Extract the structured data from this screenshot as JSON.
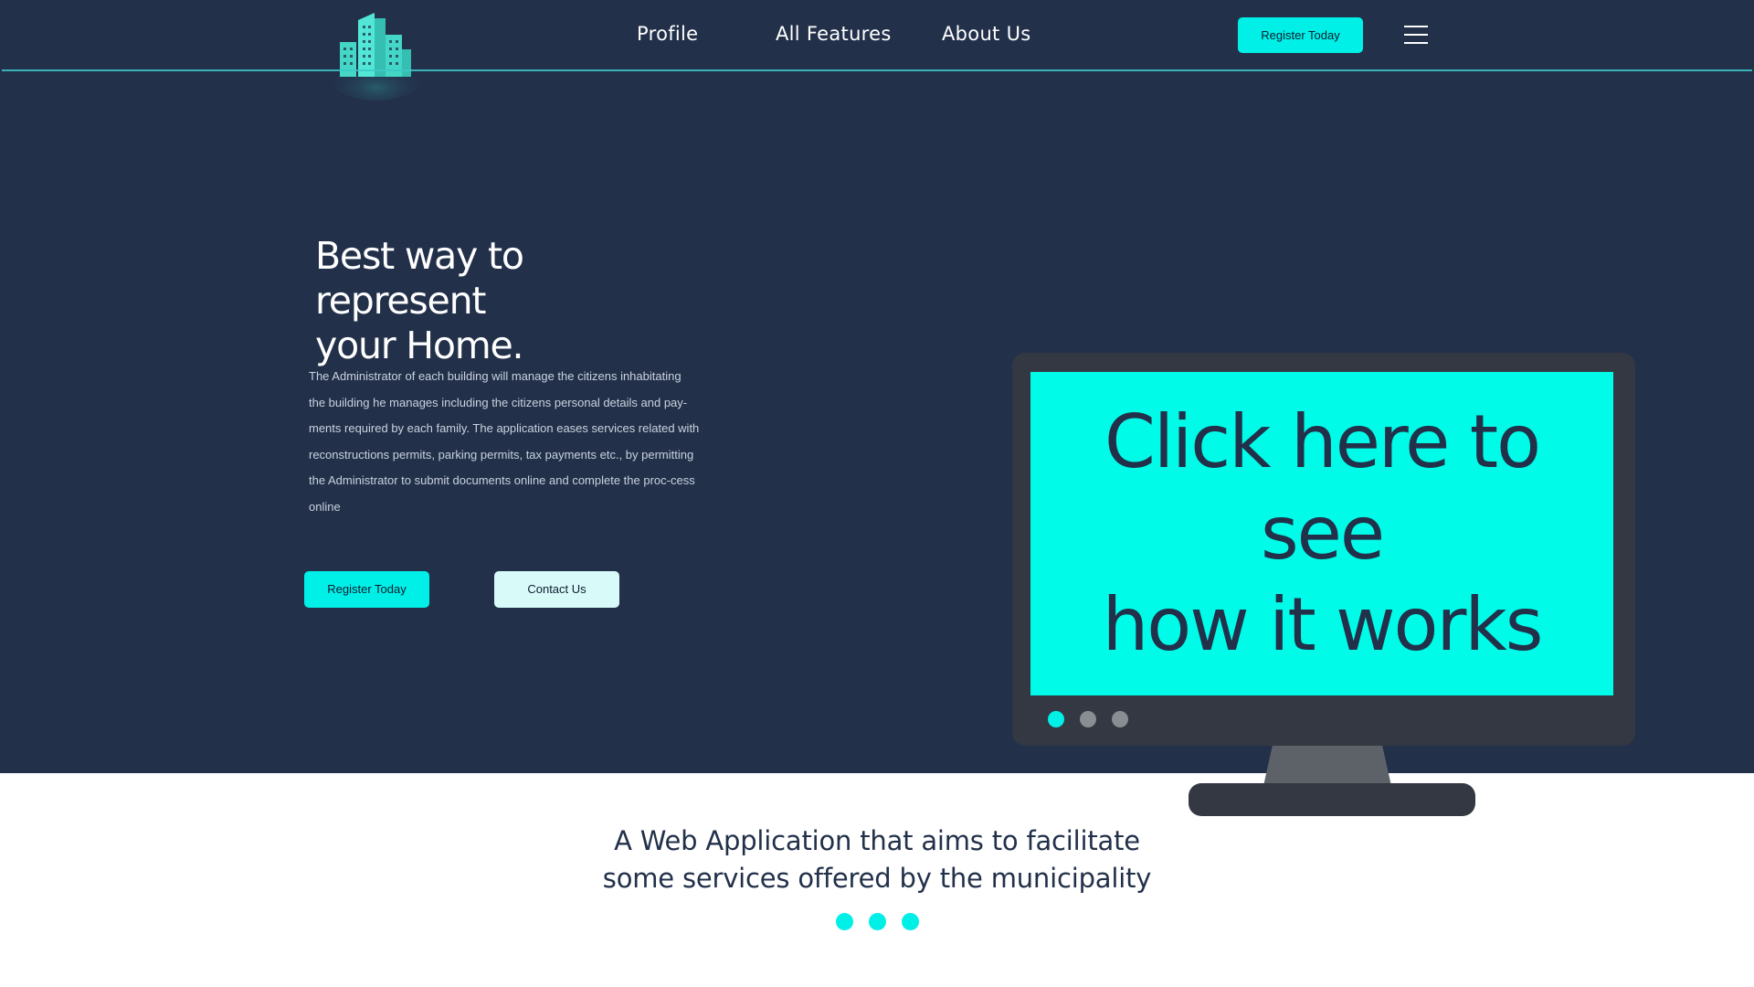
{
  "nav": {
    "links": [
      "Profile",
      "All Features",
      "About Us"
    ],
    "register_button": "Register Today"
  },
  "hero": {
    "title_line1": "Best way to represent",
    "title_line2": "your Home.",
    "description": "The Administrator of each building will manage the citizens inhabitating the building he manages including the citizens personal details and pay-ments required by each family. The application eases services related with reconstructions permits, parking permits, tax payments etc., by permitting the Administrator to submit documents online and complete the proc-cess online",
    "register_button": "Register Today",
    "contact_button": "Contact Us"
  },
  "monitor": {
    "cta_line1": "Click here to see",
    "cta_line2": "how it works",
    "carousel_dots": [
      {
        "color": "#00f0e8",
        "active": true
      },
      {
        "color": "#8a8d92",
        "active": false
      },
      {
        "color": "#8a8d92",
        "active": false
      }
    ]
  },
  "tagline": {
    "line1": "A Web Application that aims to facilitate",
    "line2": "some services offered by the municipality"
  },
  "colors": {
    "navy": "#22304a",
    "accent_cyan": "#00f0e8",
    "screen_cyan": "#00fce8",
    "monitor_dark": "#343842",
    "light_button": "#d8fbfa"
  },
  "icons": [
    "building-logo-icon",
    "hamburger-menu-icon"
  ]
}
